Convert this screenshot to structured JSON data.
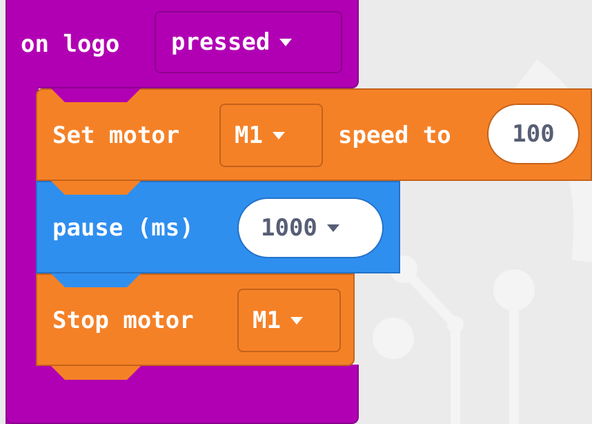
{
  "colors": {
    "event_block": "#b100b3",
    "event_block_border": "#8c0090",
    "motor_block": "#f58127",
    "motor_block_border": "#c4621a",
    "basic_block": "#2f8fef",
    "basic_block_border": "#2272c9",
    "field_text": "#575e75",
    "workspace": "#ebebeb"
  },
  "event": {
    "prefix": "on logo",
    "dropdown": "pressed"
  },
  "set_motor": {
    "prefix": "Set motor",
    "motor": "M1",
    "middle": "speed to",
    "speed": "100"
  },
  "pause": {
    "prefix": "pause (ms)",
    "duration": "1000"
  },
  "stop_motor": {
    "prefix": "Stop motor",
    "motor": "M1"
  },
  "icons": {
    "dropdown": "caret-down-icon"
  }
}
